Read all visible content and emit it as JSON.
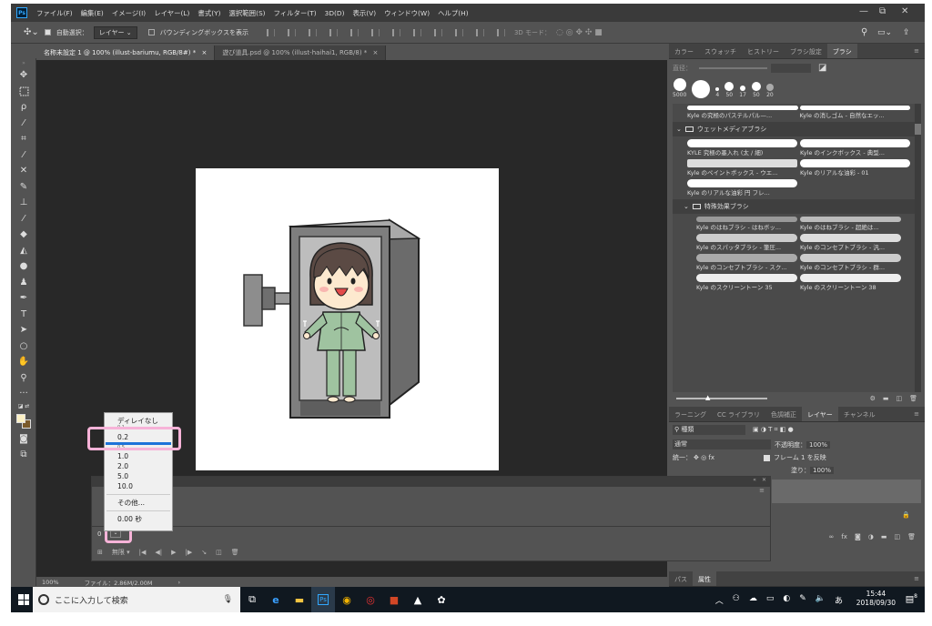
{
  "app": {
    "logo": "Ps"
  },
  "menubar": {
    "items": [
      "ファイル(F)",
      "編集(E)",
      "イメージ(I)",
      "レイヤー(L)",
      "書式(Y)",
      "選択範囲(S)",
      "フィルター(T)",
      "3D(D)",
      "表示(V)",
      "ウィンドウ(W)",
      "ヘルプ(H)"
    ],
    "window_controls": [
      "—",
      "⧉",
      "✕"
    ]
  },
  "options": {
    "auto_select_label": "自動選択：",
    "layer_select": "レイヤー",
    "bounding_box_label": "バウンディングボックスを表示",
    "mode_3d": "3D モード："
  },
  "tabs": [
    {
      "label": "名称未設定 1 @ 100% (illust-bariumu, RGB/8#) *",
      "close": "×"
    },
    {
      "label": "遊び道具.psd @ 100% (illust-haihai1, RGB/8) *",
      "close": "×"
    }
  ],
  "tools": [
    "move",
    "marquee",
    "lasso",
    "quick-select",
    "crop",
    "eyedropper",
    "healing",
    "brush",
    "stamp",
    "history-brush",
    "eraser",
    "gradient",
    "blur",
    "dodge",
    "pen",
    "type",
    "path-select",
    "shape",
    "hand",
    "zoom",
    "more",
    "fg-bg-swap",
    "colors",
    "quick-mask",
    "screen-mode"
  ],
  "brush_panel": {
    "tabs": [
      "カラー",
      "スウォッチ",
      "ヒストリー",
      "ブラシ設定",
      "ブラシ"
    ],
    "active_tab": "ブラシ",
    "size_label": "直径：",
    "presets": [
      "5000",
      "4",
      "50",
      "17",
      "50",
      "20"
    ],
    "items_top": [
      "Kyle の究極のパステルパル—...",
      "Kyle の消しゴム - 自然なエッ..."
    ],
    "folder_wet": "ウェットメディアブラシ",
    "items_wet": [
      "KYLE 究極の墨入れ (太 / 細)",
      "Kyle のインクボックス - 典型...",
      "Kyle のペイントボックス - ウエ...",
      "Kyle のリアルな油彩 - 01",
      "Kyle のリアルな油彩 円 フレ..."
    ],
    "folder_fx": "特殊効果ブラシ",
    "items_fx": [
      "Kyle のはねブラシ - はねボッ...",
      "Kyle のはねブラシ - 超絶は...",
      "Kyle のスパッタブラシ - 筆圧...",
      "Kyle のコンセプトブラシ - 汎...",
      "Kyle のコンセプトブラシ - スク...",
      "Kyle のコンセプトブラシ - 群...",
      "Kyle のスクリーントーン 35",
      "Kyle のスクリーントーン 38"
    ]
  },
  "layers_panel": {
    "tabs": [
      "ラーニング",
      "CC ライブラリ",
      "色調補正",
      "レイヤー",
      "チャンネル"
    ],
    "active_tab": "レイヤー",
    "filter_label": "種類",
    "blend_mode": "通常",
    "opacity_label": "不透明度：",
    "opacity_value": "100%",
    "unify_label": "統一：",
    "propagate_label": "フレーム 1 を反映",
    "fill_label": "塗り：",
    "fill_value": "100%",
    "bottom_tabs": [
      "パス",
      "属性"
    ]
  },
  "timeline": {
    "frame_time": "0",
    "loop_label": "無限",
    "delay_menu": {
      "items": [
        "ディレイなし",
        "0.1",
        "0.2",
        "0.5",
        "1.0",
        "2.0",
        "5.0",
        "10.0",
        "その他...",
        "0.00 秒"
      ],
      "selected": "0.2"
    }
  },
  "status": {
    "zoom": "100%",
    "file_info": "ファイル：2.86M/2.00M"
  },
  "taskbar": {
    "search_placeholder": "ここに入力して検索",
    "time": "15:44",
    "date": "2018/09/30",
    "ime": "あ",
    "notifications": "8"
  },
  "colors": {
    "accent": "#1e73d9",
    "highlight": "#f7b3d8",
    "ps_blue": "#31a8ff"
  }
}
